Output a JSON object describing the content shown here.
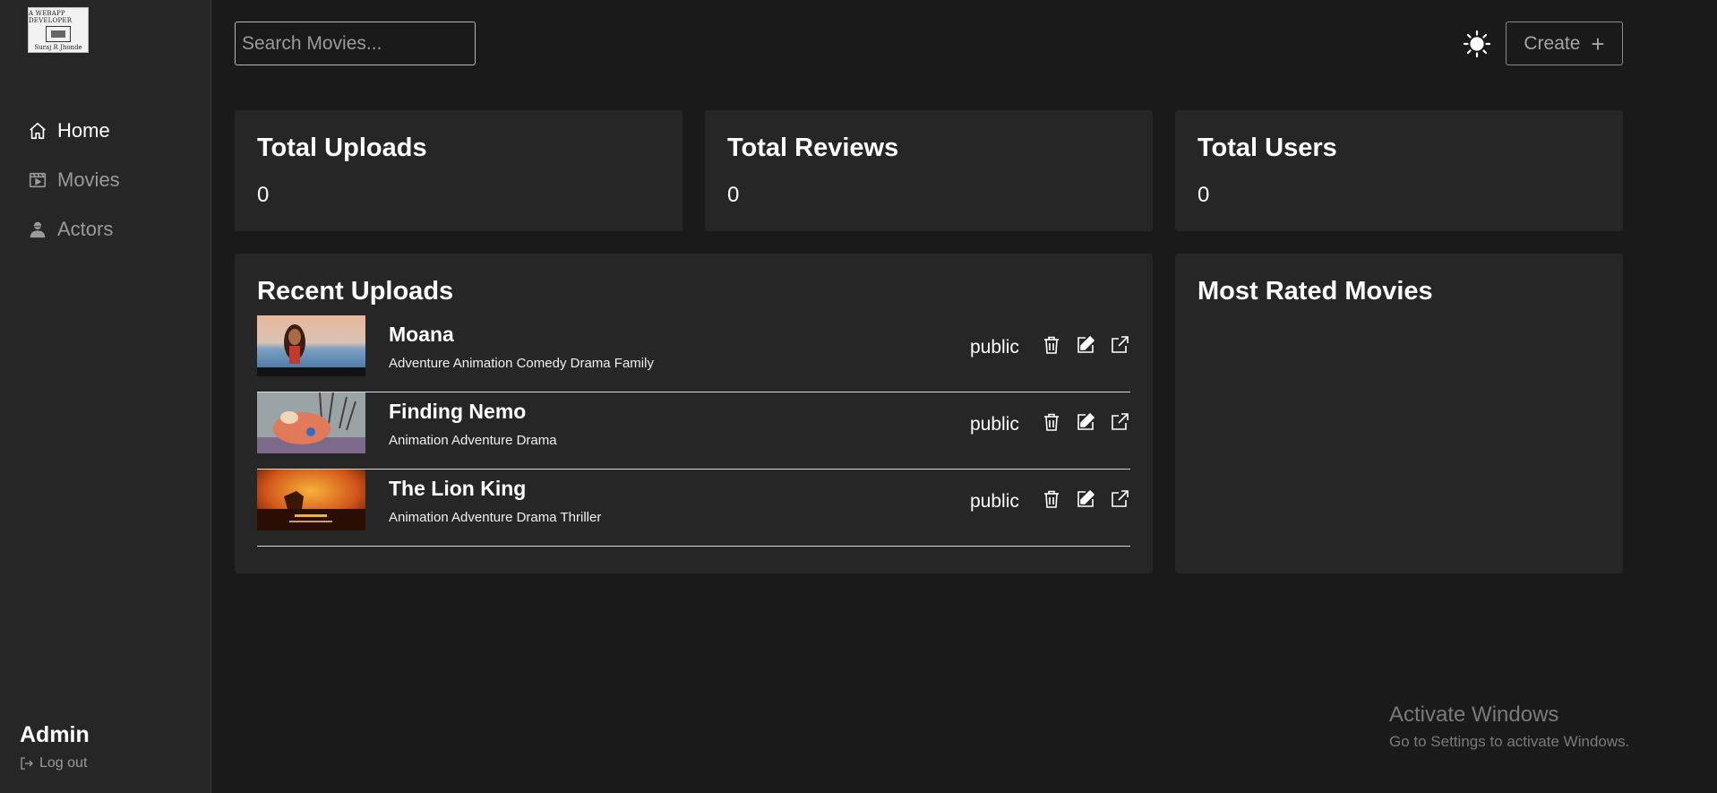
{
  "sidebar": {
    "logo": {
      "top_text": "A WEBAPP DEVELOPER",
      "bottom_text": "Suraj R Jhonde"
    },
    "items": [
      {
        "label": "Home",
        "icon": "home-icon",
        "active": true
      },
      {
        "label": "Movies",
        "icon": "film-icon",
        "active": false
      },
      {
        "label": "Actors",
        "icon": "user-icon",
        "active": false
      }
    ],
    "user": {
      "name": "Admin",
      "logout_label": "Log out"
    }
  },
  "header": {
    "search_placeholder": "Search Movies...",
    "create_label": "Create",
    "theme_icon": "sun-icon"
  },
  "stats": [
    {
      "title": "Total Uploads",
      "value": "0"
    },
    {
      "title": "Total Reviews",
      "value": "0"
    },
    {
      "title": "Total Users",
      "value": "0"
    }
  ],
  "recent": {
    "title": "Recent Uploads",
    "movies": [
      {
        "title": "Moana",
        "genres": "Adventure Animation Comedy Drama Family",
        "status": "public"
      },
      {
        "title": "Finding Nemo",
        "genres": "Animation Adventure Drama",
        "status": "public"
      },
      {
        "title": "The Lion King",
        "genres": "Animation Adventure Drama Thriller",
        "status": "public"
      }
    ]
  },
  "most_rated": {
    "title": "Most Rated Movies"
  },
  "watermark": {
    "title": "Activate Windows",
    "subtitle": "Go to Settings to activate Windows."
  },
  "colors": {
    "background": "#1a1a1a",
    "card": "#262626",
    "sidebar": "#262626",
    "muted_text": "#9a9a9a"
  }
}
